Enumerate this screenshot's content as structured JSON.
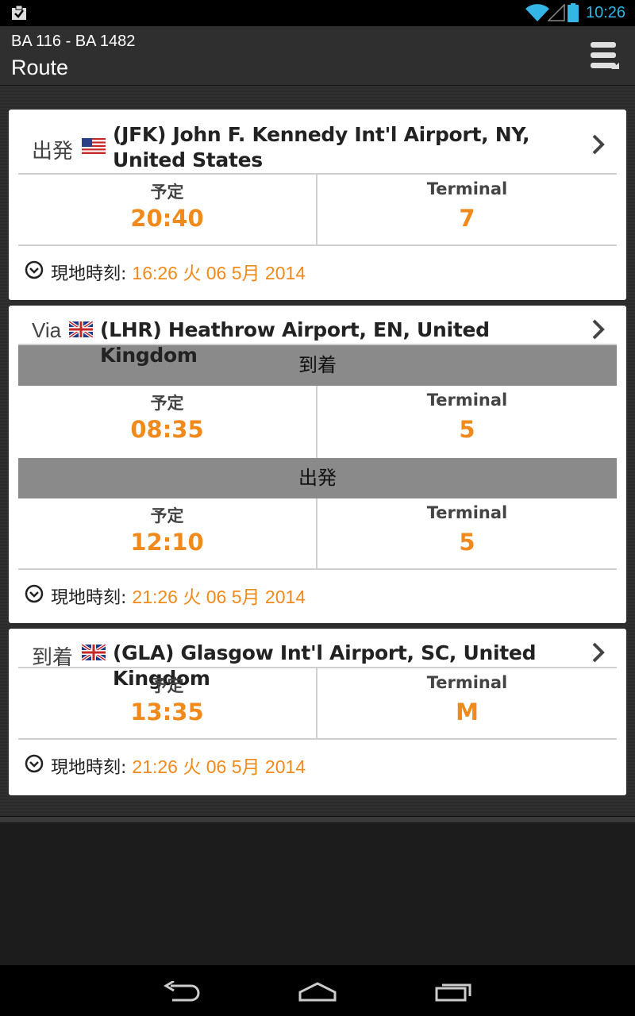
{
  "status": {
    "time": "10:26"
  },
  "header": {
    "subtitle": "BA 116 - BA 1482",
    "title": "Route"
  },
  "legs": [
    {
      "label": "出発",
      "airport": "(JFK) John F. Kennedy Int'l Airport, NY, United States",
      "flag": "us-flag-icon",
      "rows": [
        {
          "scheduled_label": "予定",
          "scheduled": "20:40",
          "terminal_label": "Terminal",
          "terminal": "7"
        }
      ],
      "local_label": "現地時刻:",
      "local_time": "16:26 火 06 5月 2014"
    },
    {
      "label": "Via",
      "airport": "(LHR) Heathrow Airport, EN, United Kingdom",
      "flag": "uk-flag-icon",
      "sections": [
        {
          "title": "到着",
          "scheduled_label": "予定",
          "scheduled": "08:35",
          "terminal_label": "Terminal",
          "terminal": "5"
        },
        {
          "title": "出発",
          "scheduled_label": "予定",
          "scheduled": "12:10",
          "terminal_label": "Terminal",
          "terminal": "5"
        }
      ],
      "local_label": "現地時刻:",
      "local_time": "21:26 火 06 5月 2014"
    },
    {
      "label": "到着",
      "airport": "(GLA) Glasgow Int'l Airport, SC, United Kingdom",
      "flag": "uk-flag-icon",
      "rows": [
        {
          "scheduled_label": "予定",
          "scheduled": "13:35",
          "terminal_label": "Terminal",
          "terminal": "M"
        }
      ],
      "local_label": "現地時刻:",
      "local_time": "21:26 火 06 5月 2014"
    }
  ],
  "colors": {
    "accent": "#f08a1c",
    "status_blue": "#33b5e5",
    "section_gray": "#8a8a8a"
  }
}
